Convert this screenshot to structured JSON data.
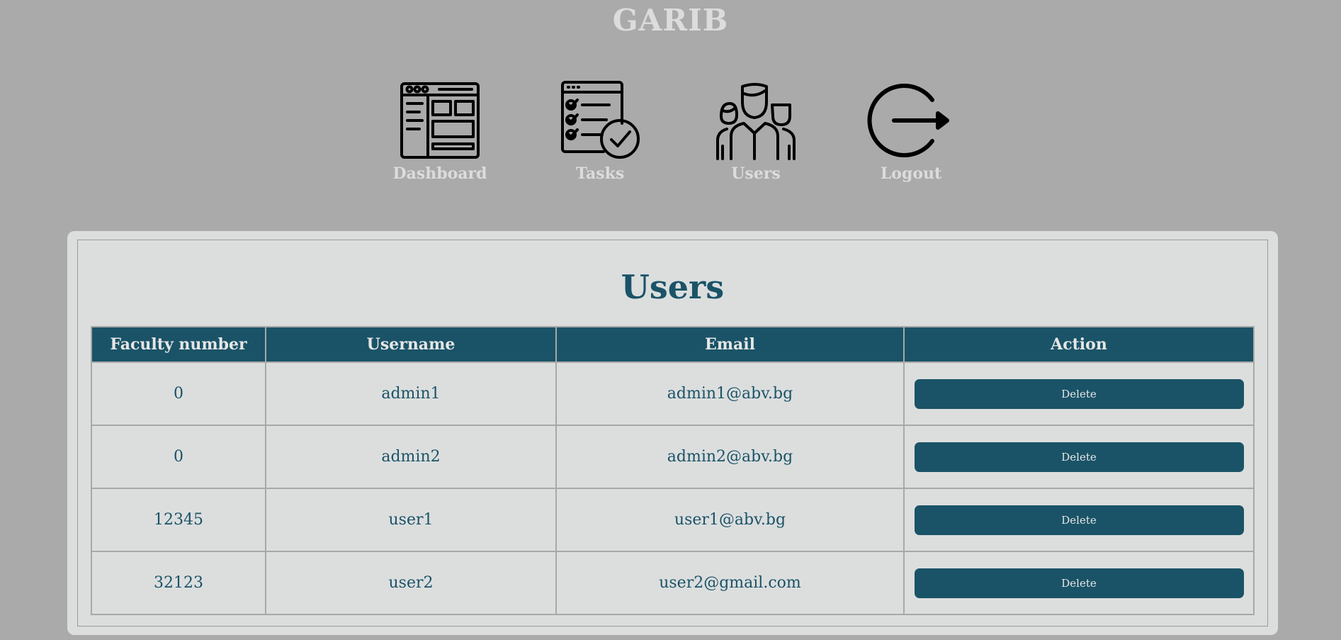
{
  "brand": "GARIB",
  "nav": [
    {
      "label": "Dashboard",
      "icon": "dashboard-icon"
    },
    {
      "label": "Tasks",
      "icon": "tasks-checklist-icon"
    },
    {
      "label": "Users",
      "icon": "users-group-icon"
    },
    {
      "label": "Logout",
      "icon": "logout-icon"
    }
  ],
  "page_title": "Users",
  "table": {
    "headers": [
      "Faculty number",
      "Username",
      "Email",
      "Action"
    ],
    "rows": [
      {
        "faculty_number": "0",
        "username": "admin1",
        "email": "admin1@abv.bg",
        "action": "Delete"
      },
      {
        "faculty_number": "0",
        "username": "admin2",
        "email": "admin2@abv.bg",
        "action": "Delete"
      },
      {
        "faculty_number": "12345",
        "username": "user1",
        "email": "user1@abv.bg",
        "action": "Delete"
      },
      {
        "faculty_number": "32123",
        "username": "user2",
        "email": "user2@gmail.com",
        "action": "Delete"
      }
    ]
  },
  "colors": {
    "background": "#aaaaaa",
    "panel": "#dcdede",
    "accent": "#1a5367",
    "nav_text": "#dcdcdc"
  }
}
